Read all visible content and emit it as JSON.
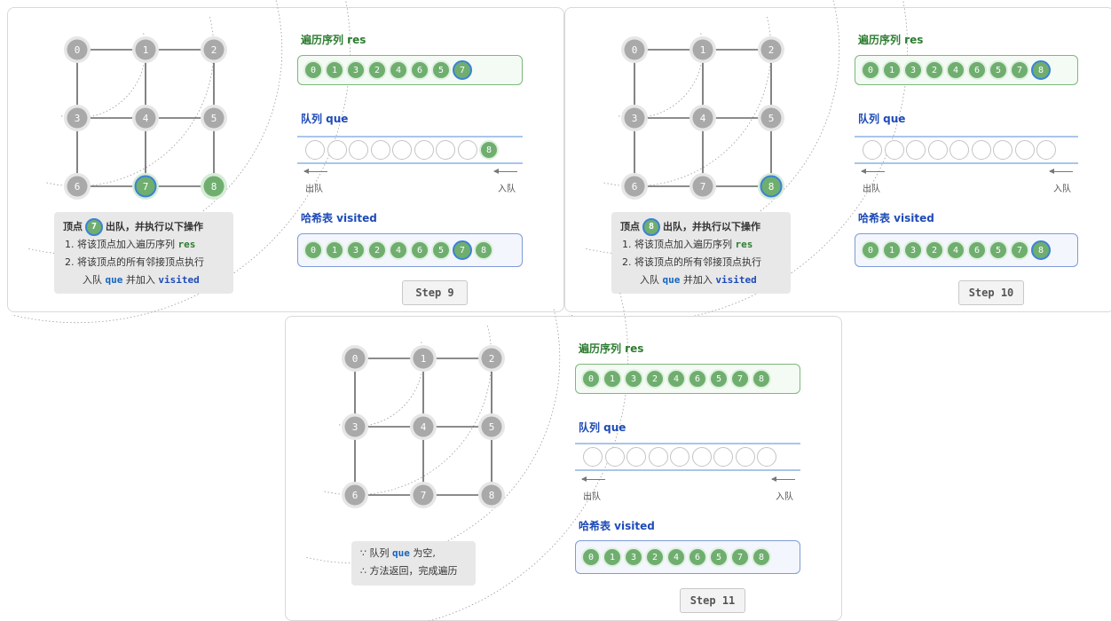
{
  "labels": {
    "res": "遍历序列 res",
    "queue": "队列 que",
    "visited": "哈希表 visited",
    "dequeue": "出队",
    "enqueue": "入队"
  },
  "nodes": [
    "0",
    "1",
    "2",
    "3",
    "4",
    "5",
    "6",
    "7",
    "8"
  ],
  "notes": {
    "vertex_prefix": "顶点",
    "dequeue_suffix": "出队，并执行以下操作",
    "item1_text": "1. 将该顶点加入遍历序列",
    "item1_kw": "res",
    "item2_line1": "2. 将该顶点的所有邻接顶点执行",
    "item2_line2_a": "入队",
    "item2_line2_kw": "que",
    "item2_line2_b": "并加入",
    "item2_line2_kw2": "visited",
    "final_line1_a": "∵ 队列",
    "final_line1_kw": "que",
    "final_line1_b": "为空,",
    "final_line2": "∴ 方法返回，完成遍历"
  },
  "steps": [
    {
      "label": "Step 9",
      "current": "7",
      "res": [
        "0",
        "1",
        "3",
        "2",
        "4",
        "6",
        "5",
        "7"
      ],
      "queue": [
        "8"
      ],
      "visited": [
        "0",
        "1",
        "3",
        "2",
        "4",
        "6",
        "5",
        "7",
        "8"
      ],
      "graph_visited": [
        "7",
        "8"
      ],
      "highlight": "7"
    },
    {
      "label": "Step 10",
      "current": "8",
      "res": [
        "0",
        "1",
        "3",
        "2",
        "4",
        "6",
        "5",
        "7",
        "8"
      ],
      "queue": [],
      "visited": [
        "0",
        "1",
        "3",
        "2",
        "4",
        "6",
        "5",
        "7",
        "8"
      ],
      "graph_visited": [
        "8"
      ],
      "highlight": "8"
    },
    {
      "label": "Step 11",
      "current": "",
      "res": [
        "0",
        "1",
        "3",
        "2",
        "4",
        "6",
        "5",
        "7",
        "8"
      ],
      "queue": [],
      "visited": [
        "0",
        "1",
        "3",
        "2",
        "4",
        "6",
        "5",
        "7",
        "8"
      ],
      "graph_visited": [],
      "highlight": ""
    }
  ],
  "colors": {
    "visited_node": "#6fae6f",
    "unvisited_node": "#a9a9a9",
    "highlight_ring": "#3b82d6",
    "green_text": "#2e7d32",
    "blue_text": "#1e4bb8"
  }
}
